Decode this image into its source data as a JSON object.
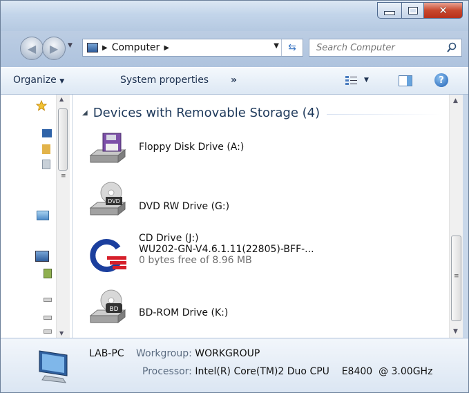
{
  "window": {
    "buttons": {
      "minimize": "minimize",
      "maximize": "maximize",
      "close": "close"
    }
  },
  "navigation": {
    "address_crumbs": [
      "Computer"
    ],
    "search_placeholder": "Search Computer"
  },
  "toolbar": {
    "organize_label": "Organize",
    "system_properties_label": "System properties",
    "more_label": "»"
  },
  "content": {
    "group_title": "Devices with Removable Storage (4)",
    "drives": [
      {
        "label": "Floppy Disk Drive (A:)",
        "icon": "floppy-drive-icon"
      },
      {
        "label": "DVD RW Drive (G:)",
        "icon": "dvd-drive-icon",
        "badge": "DVD"
      },
      {
        "label": "CD Drive (J:)",
        "volume": "WU202-GN-V4.6.1.11(22805)-BFF-...",
        "free": "0 bytes free of 8.96 MB",
        "icon": "cd-drive-autorun-icon"
      },
      {
        "label": "BD-ROM Drive (K:)",
        "icon": "bd-drive-icon",
        "badge": "BD"
      }
    ]
  },
  "details": {
    "computer_name": "LAB-PC",
    "workgroup_label": "Workgroup:",
    "workgroup_value": "WORKGROUP",
    "processor_label": "Processor:",
    "processor_value": "Intel(R) Core(TM)2 Duo CPU    E8400  @ 3.00GHz"
  },
  "colors": {
    "title_bar": "#c3d5ea",
    "close_button": "#c8472d",
    "group_header_text": "#1e395b"
  }
}
